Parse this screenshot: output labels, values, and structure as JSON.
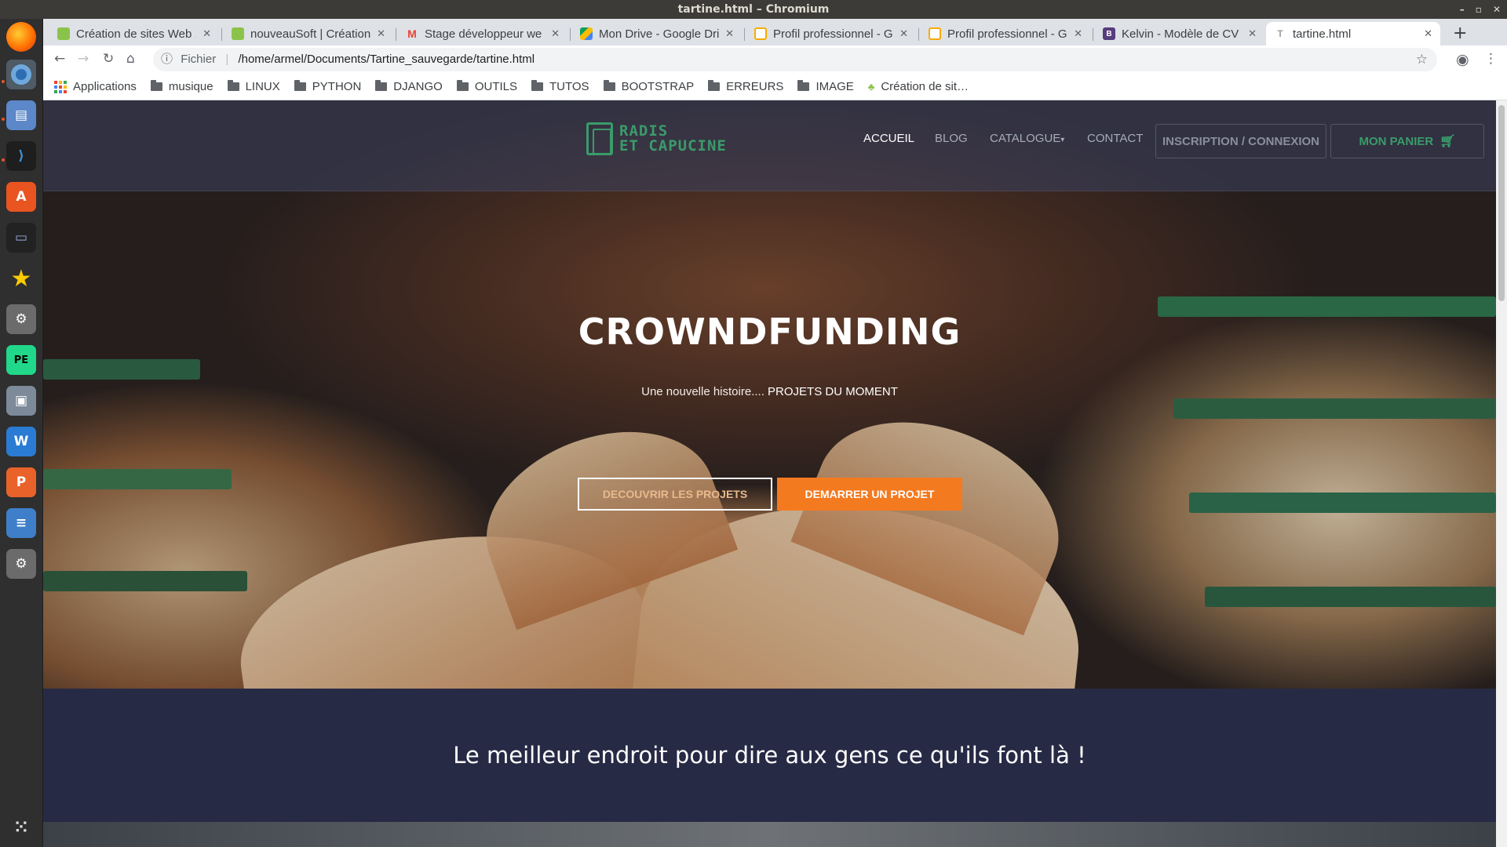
{
  "window": {
    "title": "tartine.html – Chromium"
  },
  "tabs": [
    {
      "title": "Création de sites Web ,",
      "favicon_color": "#8bc34a",
      "favicon": "leaf-icon"
    },
    {
      "title": "nouveauSoft | Création",
      "favicon_color": "#8bc34a",
      "favicon": "leaf-icon"
    },
    {
      "title": "Stage développeur we",
      "favicon_color": "#ea4335",
      "favicon": "gmail-icon"
    },
    {
      "title": "Mon Drive - Google Dri",
      "favicon_color": "#fbbc04",
      "favicon": "drive-icon"
    },
    {
      "title": "Profil professionnel - G",
      "favicon_color": "#f9ab00",
      "favicon": "slides-icon"
    },
    {
      "title": "Profil professionnel - G",
      "favicon_color": "#f9ab00",
      "favicon": "slides-icon"
    },
    {
      "title": "Kelvin - Modèle de CV B",
      "favicon_color": "#563d7c",
      "favicon": "bootstrap-icon"
    },
    {
      "title": "tartine.html",
      "favicon_color": "#9aa0a6",
      "favicon": "file-icon",
      "active": true
    }
  ],
  "address": {
    "scheme_label": "Fichier",
    "url": "/home/armel/Documents/Tartine_sauvegarde/tartine.html"
  },
  "bookmarks": {
    "apps": "Applications",
    "folders": [
      "musique",
      "LINUX",
      "PYTHON",
      "DJANGO",
      "OUTILS",
      "TUTOS",
      "BOOTSTRAP",
      "ERREURS",
      "IMAGE"
    ],
    "last": "Création de sit…"
  },
  "site": {
    "logo_line1": "RADIS",
    "logo_line2": "ET CAPUCINE",
    "nav": {
      "accueil": "ACCUEIL",
      "blog": "BLOG",
      "catalogue": "CATALOGUE",
      "catalogue_caret": "▾",
      "contact": "CONTACT",
      "login": "INSCRIPTION / CONNEXION",
      "cart": "MON PANIER"
    },
    "hero": {
      "title": "CROWNDFUNDING",
      "subtitle_plain": "Une nouvelle histoire.... ",
      "subtitle_strong": "PROJETS DU MOMENT",
      "btn_discover": "DECOUVRIR LES PROJETS",
      "btn_start": "DEMARRER UN PROJET"
    },
    "tagline": "Le meilleur endroit pour dire aux gens ce qu'ils font là !"
  },
  "colors": {
    "brand_green": "#3a9b6b",
    "accent_orange": "#f47a20",
    "dark_navy": "#272a45"
  }
}
